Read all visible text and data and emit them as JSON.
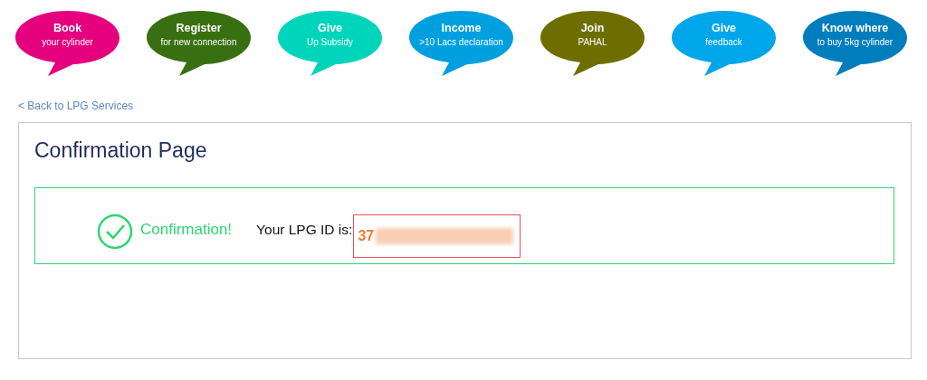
{
  "services": [
    {
      "title": "Book",
      "subtitle": "your cylinder",
      "color": "#e5007e"
    },
    {
      "title": "Register",
      "subtitle": "for new connection",
      "color": "#386f10"
    },
    {
      "title": "Give",
      "subtitle": "Up Subsidy",
      "color": "#00d5bc"
    },
    {
      "title": "Income",
      "subtitle": ">10 Lacs declaration",
      "color": "#009fe0"
    },
    {
      "title": "Join",
      "subtitle": "PAHAL",
      "color": "#6e6e00"
    },
    {
      "title": "Give",
      "subtitle": "feedback",
      "color": "#00a6ea"
    },
    {
      "title": "Know where",
      "subtitle": "to buy 5kg cylinder",
      "color": "#007dbd"
    }
  ],
  "back_link": "< Back to LPG Services",
  "page_title": "Confirmation Page",
  "confirmation": {
    "status": "Confirmation!",
    "id_label": "Your LPG ID is:",
    "id_visible": "37"
  }
}
